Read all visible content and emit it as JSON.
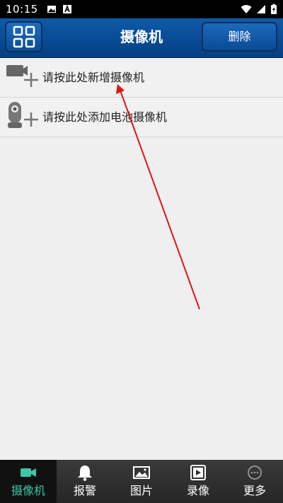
{
  "status_bar": {
    "time": "10:15",
    "left_icons": [
      "image-icon",
      "text-app-icon"
    ],
    "right_icons": [
      "wifi-icon",
      "signal-icon",
      "battery-icon"
    ]
  },
  "header": {
    "title": "摄像机",
    "delete_label": "删除",
    "grid_icon": "grid-icon",
    "background_color": "#074a93"
  },
  "list": {
    "items": [
      {
        "label": "请按此处新增摄像机",
        "icon": "add-camera-icon"
      },
      {
        "label": "请按此处添加电池摄像机",
        "icon": "add-battery-camera-icon"
      }
    ]
  },
  "annotation": {
    "type": "arrow",
    "color": "#e01515"
  },
  "bottom_nav": {
    "active_color": "#3ec6a6",
    "items": [
      {
        "label": "摄像机",
        "icon": "video-camera-icon",
        "active": true
      },
      {
        "label": "报警",
        "icon": "bell-icon",
        "active": false
      },
      {
        "label": "图片",
        "icon": "picture-icon",
        "active": false
      },
      {
        "label": "录像",
        "icon": "recording-icon",
        "active": false
      },
      {
        "label": "更多",
        "icon": "more-icon",
        "active": false
      }
    ]
  }
}
